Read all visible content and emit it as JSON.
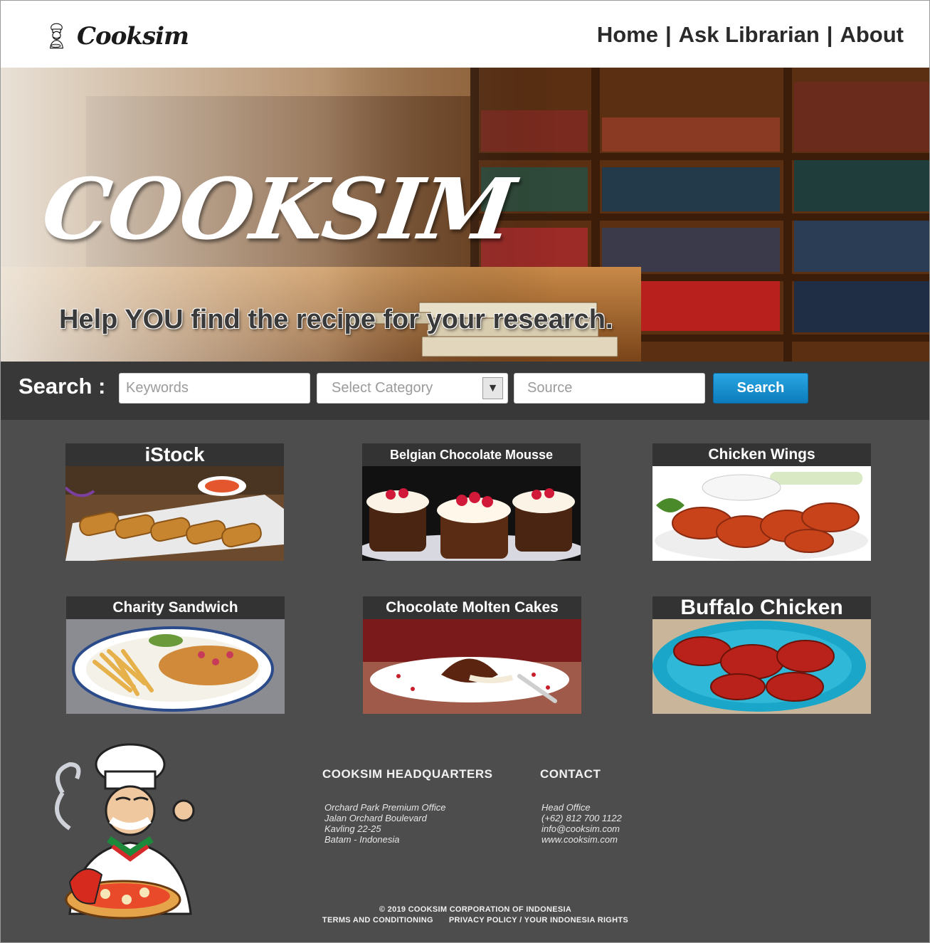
{
  "header": {
    "logo_text": "Cooksim",
    "nav": {
      "home": "Home",
      "ask": "Ask Librarian",
      "about": "About",
      "separator": "|"
    }
  },
  "hero": {
    "title": "COOKSIM",
    "tagline": "Help YOU find the recipe for your research."
  },
  "search": {
    "label": "Search :",
    "keywords_placeholder": "Keywords",
    "category_placeholder": "Select Category",
    "source_placeholder": "Source",
    "button": "Search",
    "dropdown_icon": "triangle-down-icon"
  },
  "cards": [
    {
      "title": "iStock"
    },
    {
      "title": "Belgian Chocolate Mousse"
    },
    {
      "title": "Chicken Wings"
    },
    {
      "title": "Charity Sandwich"
    },
    {
      "title": "Chocolate Molten Cakes"
    },
    {
      "title": "Buffalo Chicken"
    }
  ],
  "footer": {
    "hq_heading": "COOKSIM HEADQUARTERS",
    "hq_lines": [
      "Orchard Park Premium Office",
      "Jalan Orchard Boulevard",
      "Kavling 22-25",
      "Batam - Indonesia"
    ],
    "contact_heading": "CONTACT",
    "contact_lines": [
      "Head Office",
      "(+62) 812 700 1122",
      "info@cooksim.com",
      "www.cooksim.com"
    ],
    "copyright": "© 2019 COOKSIM CORPORATION OF INDONESIA",
    "terms": "TERMS AND CONDITIONING",
    "privacy": "PRIVACY POLICY / YOUR INDONESIA RIGHTS"
  },
  "colors": {
    "page_bg": "#4d4d4d",
    "search_bar_bg": "#383838",
    "card_title_bg": "#333333",
    "search_button": "#1a93d2"
  }
}
